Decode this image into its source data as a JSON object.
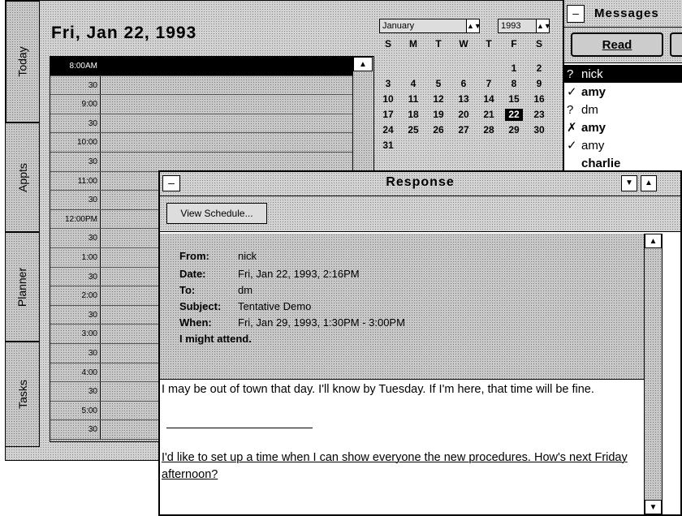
{
  "main": {
    "date_title": "Fri, Jan 22, 1993",
    "tabs": [
      "Today",
      "Appts",
      "Planner",
      "Tasks"
    ],
    "times": [
      "8:00AM",
      "30",
      "9:00",
      "30",
      "10:00",
      "30",
      "11:00",
      "30",
      "12:00PM",
      "30",
      "1:00",
      "30",
      "2:00",
      "30",
      "3:00",
      "30",
      "4:00",
      "30",
      "5:00",
      "30"
    ]
  },
  "mini_calendar": {
    "month": "January",
    "year": "1993",
    "weekdays": [
      "S",
      "M",
      "T",
      "W",
      "T",
      "F",
      "S"
    ],
    "weeks": [
      [
        "",
        "",
        "",
        "",
        "",
        "1",
        "2"
      ],
      [
        "3",
        "4",
        "5",
        "6",
        "7",
        "8",
        "9"
      ],
      [
        "10",
        "11",
        "12",
        "13",
        "14",
        "15",
        "16"
      ],
      [
        "17",
        "18",
        "19",
        "20",
        "21",
        "22",
        "23"
      ],
      [
        "24",
        "25",
        "26",
        "27",
        "28",
        "29",
        "30"
      ],
      [
        "31",
        "",
        "",
        "",
        "",
        "",
        ""
      ]
    ],
    "selected_day": "22"
  },
  "messages": {
    "title": "Messages",
    "read_button": "Read",
    "items": [
      {
        "icon": "?",
        "name": "nick",
        "bold": false
      },
      {
        "icon": "✓",
        "name": "amy",
        "bold": true
      },
      {
        "icon": "?",
        "name": "dm",
        "bold": false
      },
      {
        "icon": "✗",
        "name": "amy",
        "bold": true
      },
      {
        "icon": "✓",
        "name": "amy",
        "bold": false
      },
      {
        "icon": "",
        "name": "charlie",
        "bold": true
      }
    ]
  },
  "response": {
    "title": "Response",
    "view_schedule": "View Schedule...",
    "from_label": "From:",
    "from": "nick",
    "date_label": "Date:",
    "date": "Fri, Jan 22, 1993, 2:16PM",
    "to_label": "To:",
    "to": "dm",
    "subject_label": "Subject:",
    "subject": "Tentative Demo",
    "when_label": "When:",
    "when": "Fri, Jan 29, 1993, 1:30PM - 3:00PM",
    "status": "I might attend.",
    "body_line1": "I may be out of town that day.  I'll know by Tuesday.  If I'm here, that time will be fine.",
    "body_line2": "I'd like to set up a time when I can show everyone the new procedures.  How's next Friday afternoon?"
  }
}
